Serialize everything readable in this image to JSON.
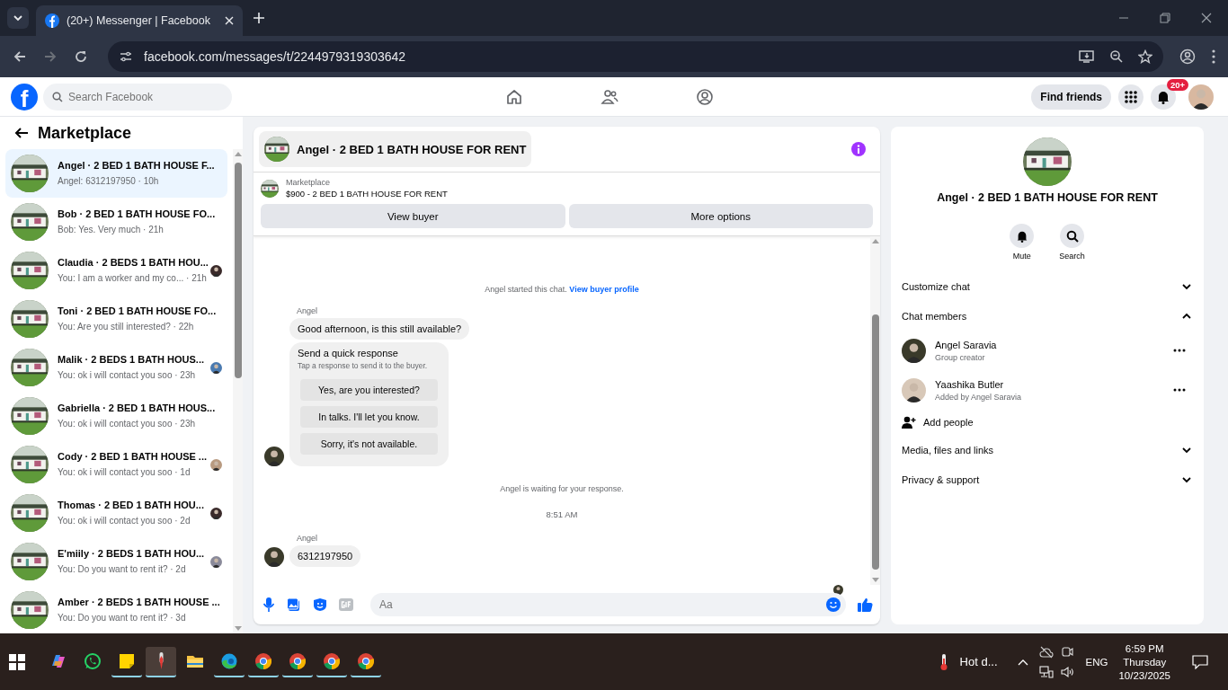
{
  "browser": {
    "tab_title": "(20+) Messenger | Facebook",
    "url": "facebook.com/messages/t/2244979319303642"
  },
  "topbar": {
    "logo": "f",
    "search_placeholder": "Search Facebook",
    "find_friends": "Find friends",
    "badge": "20+"
  },
  "sidebar": {
    "title": "Marketplace",
    "conversations": [
      {
        "title": "Angel · 2 BED 1 BATH HOUSE F...",
        "snippet": "Angel: 6312197950 · 10h",
        "selected": true,
        "seen": false
      },
      {
        "title": "Bob · 2 BED 1 BATH HOUSE FO...",
        "snippet": "Bob: Yes. Very much · 21h",
        "selected": false,
        "seen": false
      },
      {
        "title": "Claudia · 2 BEDS 1 BATH HOU...",
        "snippet": "You: I am a worker and my co... · 21h",
        "selected": false,
        "seen": true
      },
      {
        "title": "Toni · 2 BED 1 BATH HOUSE FO...",
        "snippet": "You: Are you still interested? · 22h",
        "selected": false,
        "seen": false
      },
      {
        "title": "Malik · 2 BEDS 1 BATH HOUS...",
        "snippet": "You: ok i will contact you soo · 23h",
        "selected": false,
        "seen": true
      },
      {
        "title": "Gabriella · 2 BED 1 BATH HOUS...",
        "snippet": "You: ok i will contact you soo · 23h",
        "selected": false,
        "seen": false
      },
      {
        "title": "Cody · 2 BED 1 BATH HOUSE ...",
        "snippet": "You: ok i will contact you soo · 1d",
        "selected": false,
        "seen": true
      },
      {
        "title": "Thomas · 2 BED 1 BATH HOU...",
        "snippet": "You: ok i will contact you soo · 2d",
        "selected": false,
        "seen": true
      },
      {
        "title": "E'miily · 2 BEDS 1 BATH HOU...",
        "snippet": "You: Do you want to rent it? · 2d",
        "selected": false,
        "seen": true
      },
      {
        "title": "Amber · 2 BEDS 1 BATH HOUSE ...",
        "snippet": "You: Do you want to rent it? · 3d",
        "selected": false,
        "seen": false
      }
    ]
  },
  "chat": {
    "title": "Angel · 2 BED 1 BATH HOUSE FOR RENT",
    "listing": {
      "label": "Marketplace",
      "title": "$900 - 2 BED 1 BATH HOUSE FOR RENT"
    },
    "buttons": [
      "View buyer",
      "More options"
    ],
    "messages": [
      {
        "kind": "system",
        "text": "Angel started this chat. ",
        "link": "View buyer profile"
      },
      {
        "kind": "incoming",
        "sender": "Angel",
        "bubbles": [
          {
            "kind": "text",
            "text": "Good afternoon, is this still available?"
          },
          {
            "kind": "quick",
            "title": "Send a quick response",
            "hint": "Tap a response to send it to the buyer.",
            "options": [
              "Yes, are you interested?",
              "In talks. I'll let you know.",
              "Sorry, it's not available."
            ]
          }
        ]
      },
      {
        "kind": "notice",
        "text": "Angel is waiting for your response."
      },
      {
        "kind": "time",
        "text": "8:51 AM"
      },
      {
        "kind": "incoming",
        "sender": "Angel",
        "bubbles": [
          {
            "kind": "text",
            "text": "6312197950"
          }
        ]
      }
    ],
    "composer_placeholder": "Aa"
  },
  "details": {
    "title": "Angel · 2 BED 1 BATH HOUSE FOR RENT",
    "actions": [
      {
        "kind": "bell",
        "label": "Mute"
      },
      {
        "kind": "search",
        "label": "Search"
      }
    ],
    "rows": [
      {
        "kind": "section",
        "label": "Customize chat",
        "expanded": false
      },
      {
        "kind": "section",
        "label": "Chat members",
        "expanded": true
      },
      {
        "kind": "member",
        "name": "Angel Saravia",
        "role": "Group creator"
      },
      {
        "kind": "member",
        "name": "Yaashika Butler",
        "role": "Added by Angel Saravia"
      },
      {
        "kind": "add",
        "label": "Add people"
      },
      {
        "kind": "section",
        "label": "Media, files and links",
        "expanded": false
      },
      {
        "kind": "section",
        "label": "Privacy & support",
        "expanded": false
      }
    ]
  },
  "taskbar": {
    "apps": [
      {
        "kind": "copilot",
        "running": false,
        "selected": false
      },
      {
        "kind": "whatsapp",
        "running": false,
        "selected": false
      },
      {
        "kind": "notes",
        "running": true,
        "selected": false
      },
      {
        "kind": "pin",
        "running": true,
        "selected": true
      },
      {
        "kind": "folder",
        "running": false,
        "selected": false
      },
      {
        "kind": "edge",
        "running": true,
        "selected": false
      },
      {
        "kind": "chrome",
        "running": true,
        "selected": false
      },
      {
        "kind": "chrome",
        "running": true,
        "selected": false
      },
      {
        "kind": "chrome",
        "running": true,
        "selected": false
      },
      {
        "kind": "chrome",
        "running": true,
        "selected": false
      }
    ],
    "weather": "Hot d...",
    "language": "ENG",
    "time": "6:59 PM",
    "day": "Thursday",
    "date": "10/23/2025"
  }
}
